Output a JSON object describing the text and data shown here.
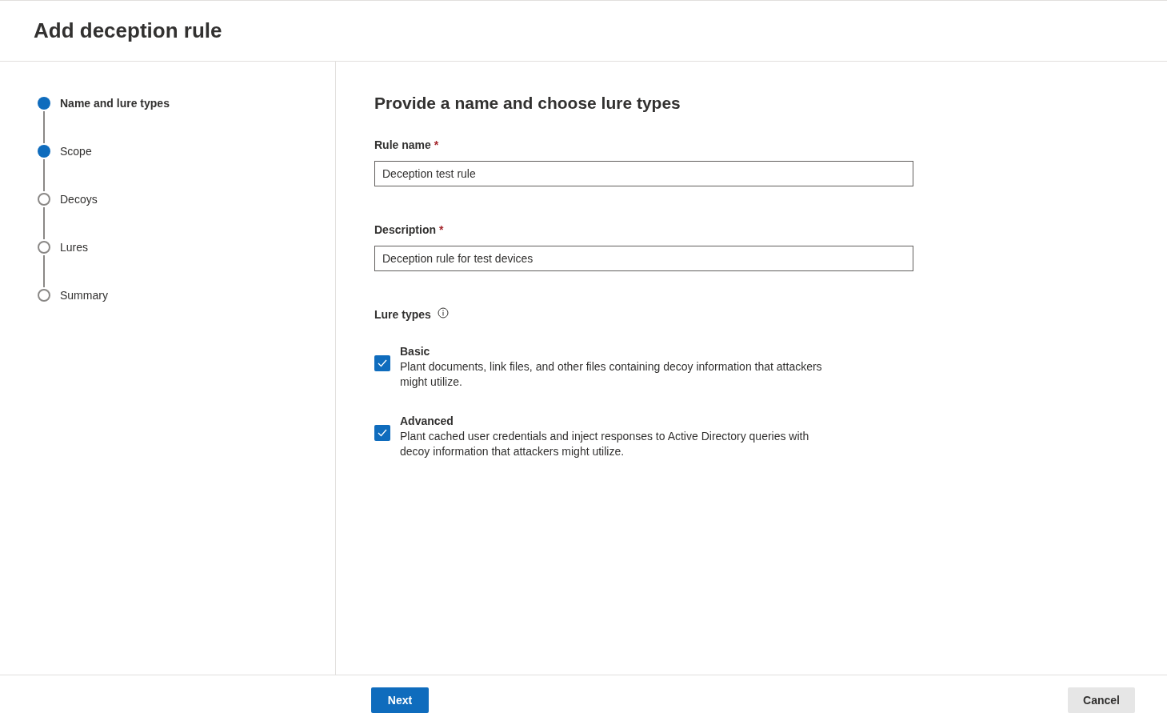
{
  "title": "Add deception rule",
  "steps": [
    {
      "label": "Name and lure types",
      "selected": true,
      "filled": true
    },
    {
      "label": "Scope",
      "selected": false,
      "filled": true
    },
    {
      "label": "Decoys",
      "selected": false,
      "filled": false
    },
    {
      "label": "Lures",
      "selected": false,
      "filled": false
    },
    {
      "label": "Summary",
      "selected": false,
      "filled": false
    }
  ],
  "heading": "Provide a name and choose lure types",
  "fields": [
    {
      "label": "Rule name",
      "required_mark": "*",
      "value": "Deception test rule"
    },
    {
      "label": "Description",
      "required_mark": "*",
      "value": "Deception rule for test devices"
    }
  ],
  "lure_types": {
    "label": "Lure types",
    "options": [
      {
        "title": "Basic",
        "description": "Plant documents, link files, and other files containing decoy information that attackers might utilize.",
        "checked": true
      },
      {
        "title": "Advanced",
        "description": "Plant cached user credentials and inject responses to Active Directory queries with decoy information that attackers might utilize.",
        "checked": true
      }
    ]
  },
  "buttons": {
    "next": "Next",
    "cancel": "Cancel"
  }
}
